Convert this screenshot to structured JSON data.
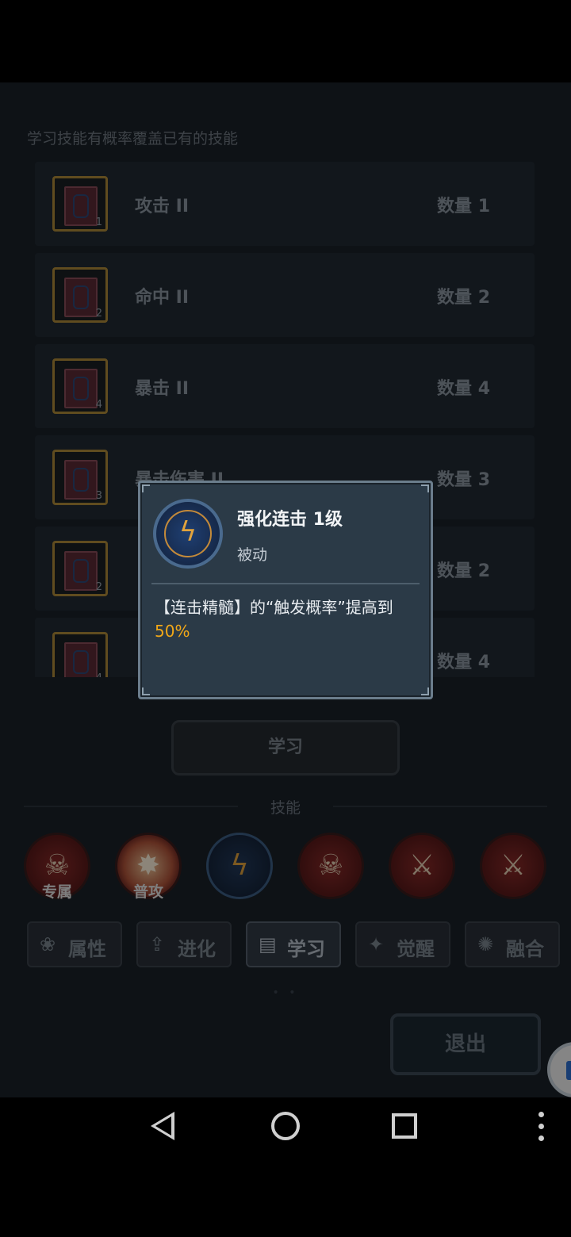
{
  "hint": "学习技能有概率覆盖已有的技能",
  "books": [
    {
      "level": "1",
      "name": "攻击 II",
      "quantity": "数量 1"
    },
    {
      "level": "2",
      "name": "命中 II",
      "quantity": "数量 2"
    },
    {
      "level": "4",
      "name": "暴击 II",
      "quantity": "数量 4"
    },
    {
      "level": "3",
      "name": "暴击伤害 II",
      "quantity": "数量 3"
    },
    {
      "level": "2",
      "name": "",
      "quantity": "数量 2"
    },
    {
      "level": "4",
      "name": "",
      "quantity": "数量 4"
    }
  ],
  "learn_button": "学习",
  "skills_label": "技能",
  "skills": [
    {
      "tag": "专属",
      "icon": "skull-icon"
    },
    {
      "tag": "普攻",
      "icon": "burst-icon"
    },
    {
      "tag": "",
      "icon": "wand-icon"
    },
    {
      "tag": "",
      "icon": "skull-icon"
    },
    {
      "tag": "",
      "icon": "sword-icon"
    },
    {
      "tag": "",
      "icon": "sword-icon"
    }
  ],
  "tabs": [
    {
      "label": "属性",
      "icon": "paw-icon"
    },
    {
      "label": "进化",
      "icon": "evolve-icon"
    },
    {
      "label": "学习",
      "icon": "book-icon"
    },
    {
      "label": "觉醒",
      "icon": "awaken-icon"
    },
    {
      "label": "融合",
      "icon": "fusion-icon"
    }
  ],
  "exit_button": "退出",
  "popup": {
    "title": "强化连击 1级",
    "type": "被动",
    "desc_prefix": "【连击精髓】的“触发概率”提高到",
    "desc_value": "50%",
    "icon": "wand-icon",
    "value_color": "#f2a818"
  }
}
